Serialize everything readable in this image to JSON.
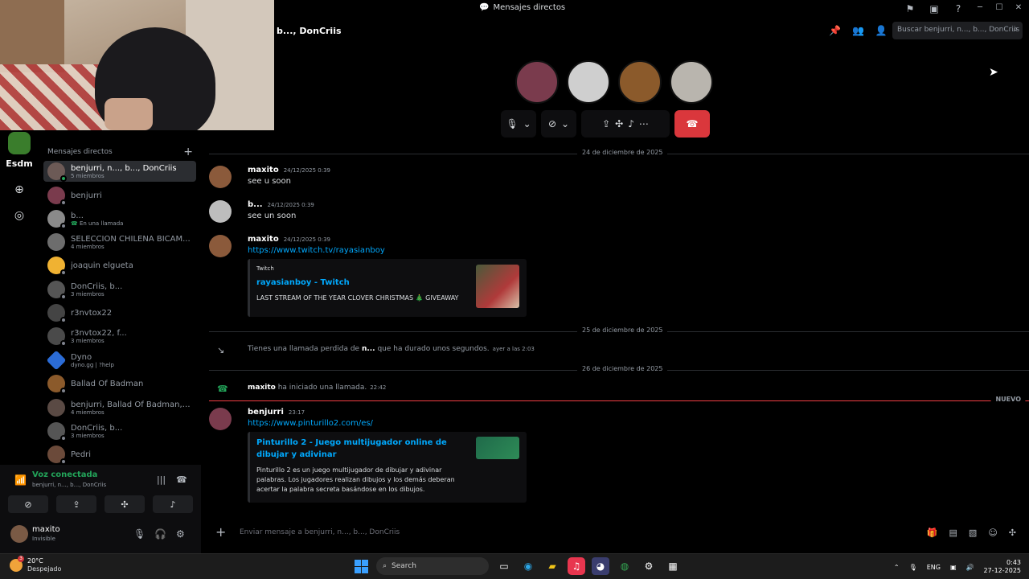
{
  "window": {
    "title": "Mensajes directos"
  },
  "call": {
    "channel_name": "b..., DonCriis",
    "search_placeholder": "Buscar benjurri, n..., b..., DonCriis",
    "participants": [
      {
        "name": "p1",
        "color": "#7a3b4d"
      },
      {
        "name": "p2",
        "color": "#cfcfcf"
      },
      {
        "name": "p3",
        "color": "#8b5a2b"
      },
      {
        "name": "p4",
        "color": "#b9b5ae"
      }
    ]
  },
  "rail": {
    "server_label": "Esdm"
  },
  "dm_list": {
    "header": "Mensajes directos",
    "items": [
      {
        "name": "benjurri, n..., b..., DonCriis",
        "sub": "5 miembros",
        "color": "#6c5a56",
        "online": true
      },
      {
        "name": "benjurri",
        "sub": "",
        "color": "#7a3b4d",
        "online": false
      },
      {
        "name": "b...",
        "sub": "En una llamada",
        "color": "#8a8a8a",
        "online": false
      },
      {
        "name": "SELECCION CHILENA BICAM...",
        "sub": "4 miembros",
        "color": "#6d6d6d",
        "online": false
      },
      {
        "name": "joaquin elgueta",
        "sub": "",
        "color": "#f0b232",
        "online": false
      },
      {
        "name": "DonCriis, b...",
        "sub": "3 miembros",
        "color": "#555",
        "online": false
      },
      {
        "name": "r3nvtox22",
        "sub": "",
        "color": "#444",
        "online": false
      },
      {
        "name": "r3nvtox22, f...",
        "sub": "3 miembros",
        "color": "#4a4a4a",
        "online": false
      },
      {
        "name": "Dyno",
        "sub": "dyno.gg | ?help",
        "color": "#2b6cd6",
        "online": false
      },
      {
        "name": "Ballad Of Badman",
        "sub": "",
        "color": "#8b5a2b",
        "online": false
      },
      {
        "name": "benjurri, Ballad Of Badman, b...",
        "sub": "4 miembros",
        "color": "#5a4a44",
        "online": false
      },
      {
        "name": "DonCriis, b...",
        "sub": "3 miembros",
        "color": "#555",
        "online": false
      },
      {
        "name": "Pedri",
        "sub": "",
        "color": "#6b4a3a",
        "online": false
      }
    ]
  },
  "voice": {
    "title": "Voz conectada",
    "channel": "benjurri, n..., b..., DonCriis"
  },
  "user": {
    "name": "maxito",
    "status": "Invisible"
  },
  "chat": {
    "date_1": "24 de diciembre de 2025",
    "date_2": "25 de diciembre de 2025",
    "date_3": "26 de diciembre de 2025",
    "new_label": "NUEVO",
    "messages": [
      {
        "author": "maxito",
        "time": "24/12/2025 0:39",
        "text": "see u soon",
        "color": "#8b5a3b"
      },
      {
        "author": "b...",
        "time": "24/12/2025 0:39",
        "text": "see un soon",
        "color": "#bdbdbd"
      },
      {
        "author": "maxito",
        "time": "24/12/2025 0:39",
        "text": "https://www.twitch.tv/rayasianboy",
        "color": "#8b5a3b"
      },
      {
        "author": "benjurri",
        "time": "23:17",
        "text": "https://www.pinturillo2.com/es/",
        "color": "#7a3b4d"
      }
    ],
    "embed_twitch": {
      "provider": "Twitch",
      "title": "rayasianboy - Twitch",
      "desc": "LAST STREAM OF THE YEAR CLOVER CHRISTMAS 🎄 GIVEAWAY"
    },
    "embed_pinturillo": {
      "title": "Pinturillo 2 - Juego multijugador online de dibujar y adivinar",
      "desc": "Pinturillo 2 es un juego multijugador de dibujar y adivinar palabras. Los jugadores realizan dibujos y los demás deberan acertar la palabra secreta basándose en los dibujos."
    },
    "missed_call": {
      "prefix": "Tienes una llamada perdida de ",
      "name": "n...",
      "suffix": " que ha durado unos segundos.",
      "time": "ayer a las 2:03"
    },
    "started_call": {
      "name": "maxito",
      "text": " ha iniciado una llamada.",
      "time": "22:42"
    }
  },
  "composer": {
    "placeholder": "Enviar mensaje a benjurri, n..., b..., DonCriis"
  },
  "taskbar": {
    "temp": "20°C",
    "condition": "Despejado",
    "badge": "3",
    "search": "Search",
    "lang": "ENG",
    "time": "0:43",
    "date": "27-12-2025"
  }
}
